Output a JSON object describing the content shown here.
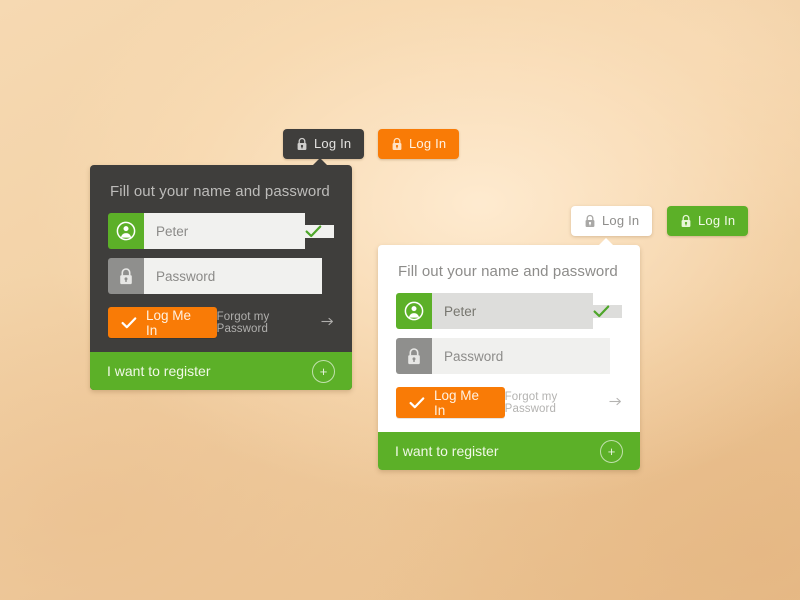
{
  "colors": {
    "dark_card": "#3f3e3c",
    "light_card": "#ffffff",
    "green": "#5cb028",
    "orange": "#f97b06",
    "grey_icon": "#8f8f8d",
    "background_start": "#f6d9b2",
    "background_end": "#e8bd89"
  },
  "buttons": {
    "login_dark": {
      "label": "Log In",
      "icon": "lock-icon"
    },
    "login_orange": {
      "label": "Log In",
      "icon": "lock-icon"
    },
    "login_white": {
      "label": "Log In",
      "icon": "lock-icon"
    },
    "login_green": {
      "label": "Log In",
      "icon": "lock-icon"
    }
  },
  "dark_card": {
    "title": "Fill out your name and password",
    "username": {
      "value": "Peter",
      "placeholder": "Peter",
      "icon": "user-avatar-icon",
      "valid_icon": "check-icon"
    },
    "password": {
      "value": "",
      "placeholder": "Password",
      "icon": "lock-icon"
    },
    "submit": {
      "label": "Log Me In",
      "icon": "check-icon"
    },
    "forgot": {
      "label": "Forgot my Password",
      "icon": "arrow-right-icon"
    },
    "register": {
      "label": "I want to register",
      "icon": "plus-icon",
      "plus": "+"
    }
  },
  "light_card": {
    "title": "Fill out your name and password",
    "username": {
      "value": "Peter",
      "placeholder": "Peter",
      "icon": "user-avatar-icon",
      "valid_icon": "check-icon"
    },
    "password": {
      "value": "",
      "placeholder": "Password",
      "icon": "lock-icon"
    },
    "submit": {
      "label": "Log Me In",
      "icon": "check-icon"
    },
    "forgot": {
      "label": "Forgot my Password",
      "icon": "arrow-right-icon"
    },
    "register": {
      "label": "I want to register",
      "icon": "plus-icon",
      "plus": "+"
    }
  }
}
